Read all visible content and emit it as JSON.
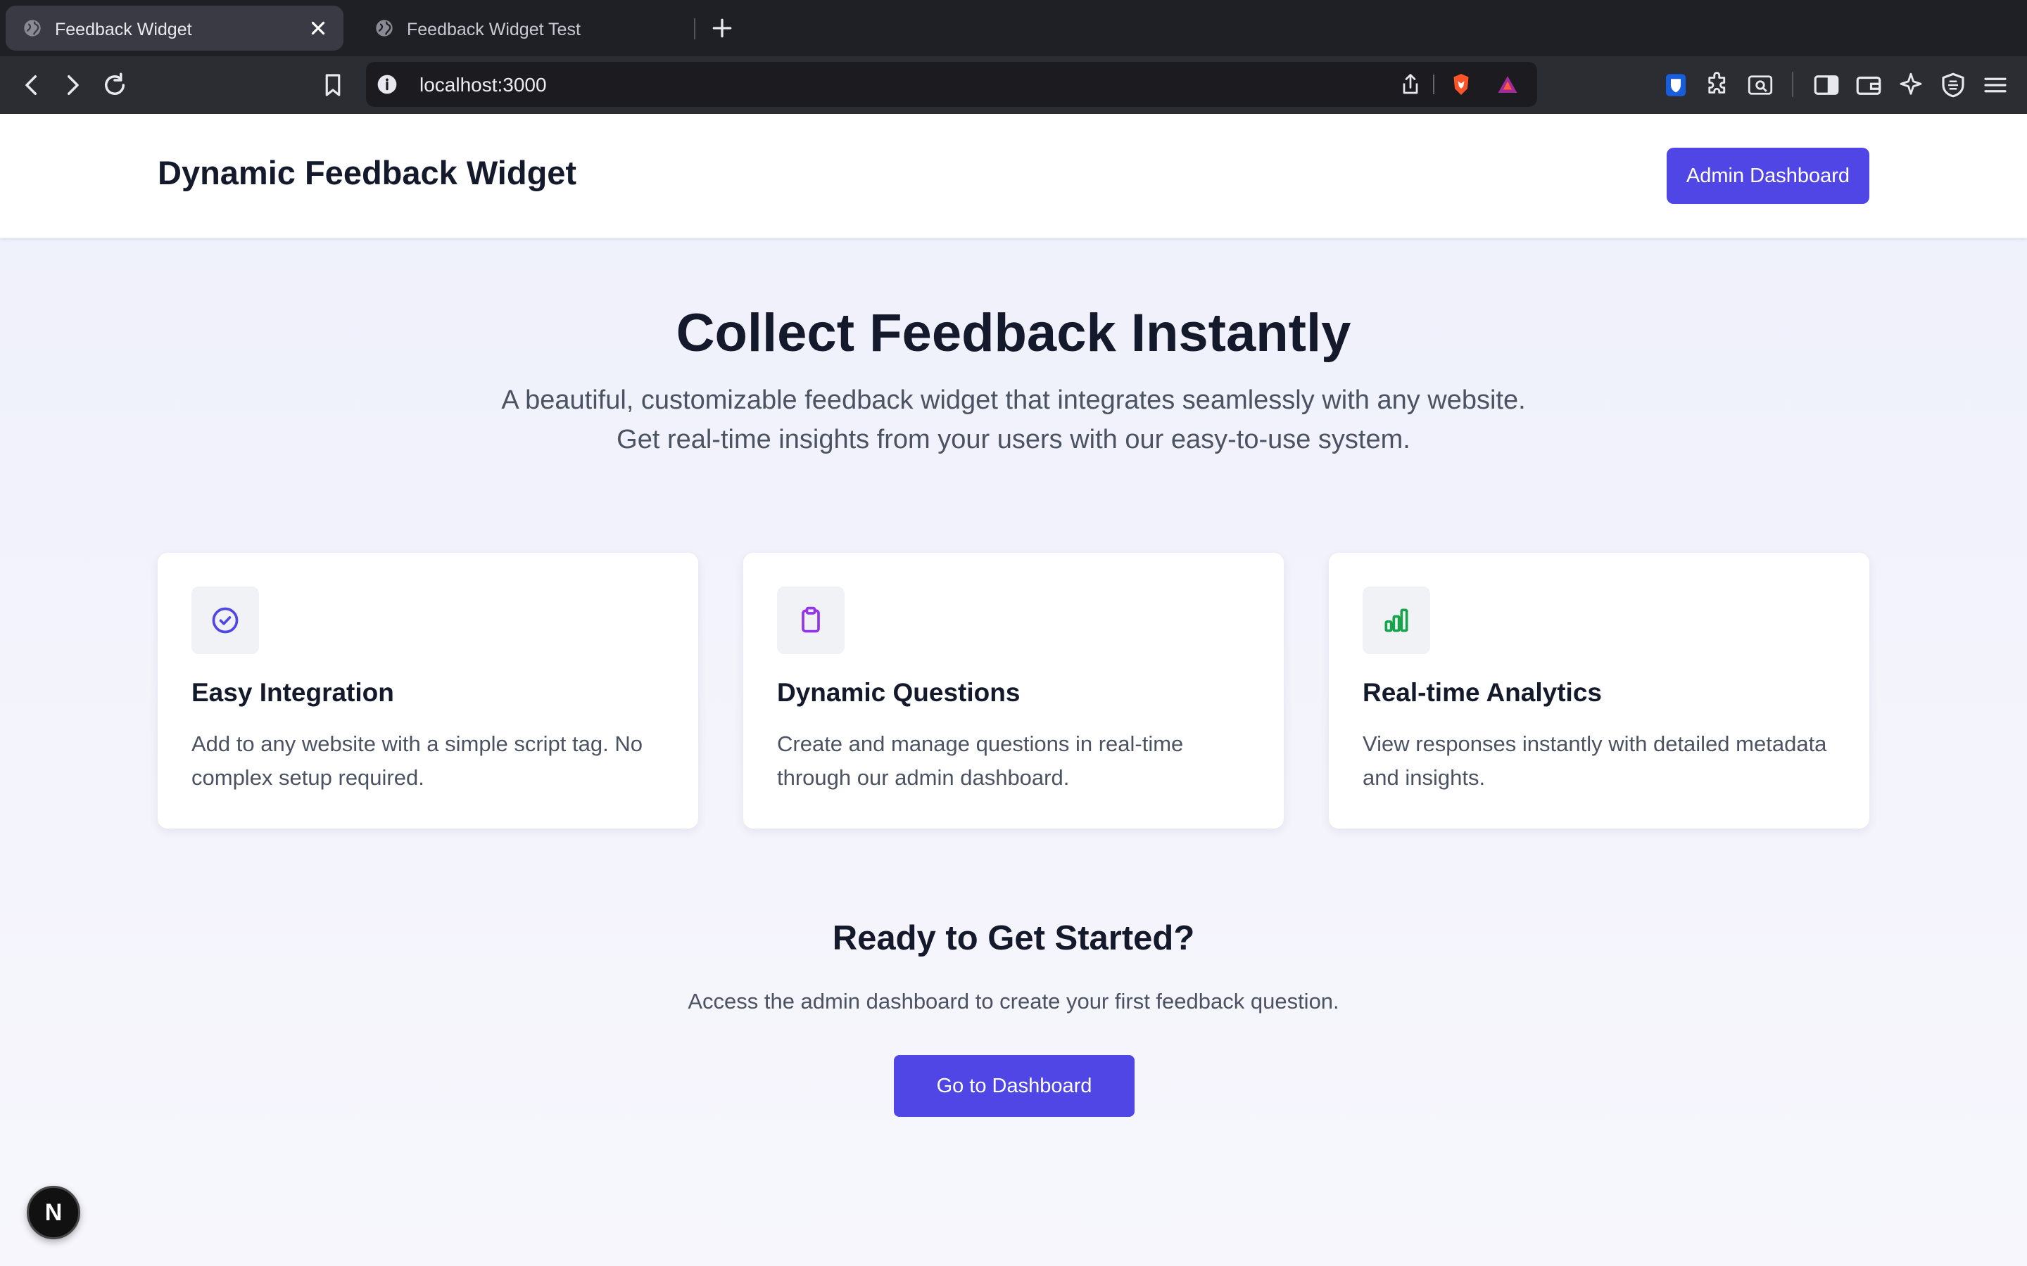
{
  "browser": {
    "tabs": [
      {
        "title": "Feedback Widget",
        "active": true
      },
      {
        "title": "Feedback Widget Test",
        "active": false
      }
    ],
    "url": "localhost:3000"
  },
  "header": {
    "brand": "Dynamic Feedback Widget",
    "admin_button": "Admin Dashboard"
  },
  "hero": {
    "title": "Collect Feedback Instantly",
    "subtitle_line1": "A beautiful, customizable feedback widget that integrates seamlessly with any website.",
    "subtitle_line2": "Get real-time insights from your users with our easy-to-use system."
  },
  "features": [
    {
      "icon": "check-circle-icon",
      "title": "Easy Integration",
      "description": "Add to any website with a simple script tag. No complex setup required.",
      "icon_color": "#4f46e5"
    },
    {
      "icon": "clipboard-icon",
      "title": "Dynamic Questions",
      "description": "Create and manage questions in real-time through our admin dashboard.",
      "icon_color": "#9333ea"
    },
    {
      "icon": "bar-chart-icon",
      "title": "Real-time Analytics",
      "description": "View responses instantly with detailed metadata and insights.",
      "icon_color": "#16a34a"
    }
  ],
  "cta": {
    "title": "Ready to Get Started?",
    "subtitle": "Access the admin dashboard to create your first feedback question.",
    "button": "Go to Dashboard"
  },
  "next_badge": "N",
  "colors": {
    "accent": "#4f46e5",
    "heading": "#141a2b",
    "body_text": "#4b5262"
  }
}
